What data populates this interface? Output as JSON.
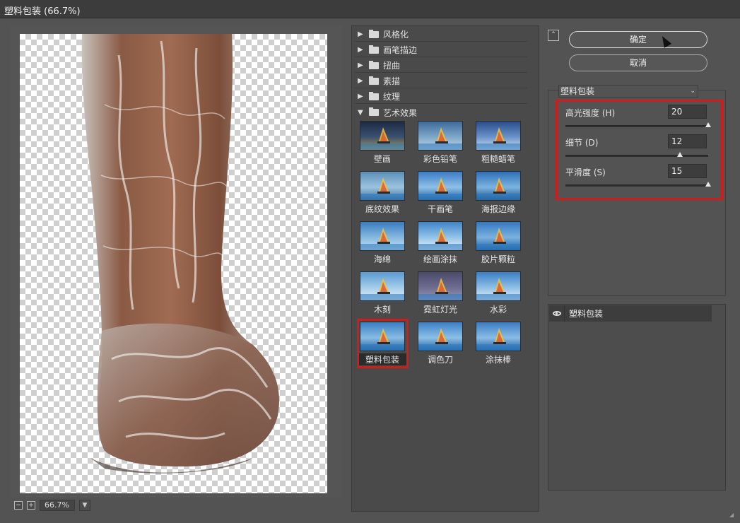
{
  "window": {
    "title": "塑料包装 (66.7%)"
  },
  "preview": {
    "zoom": "66.7%"
  },
  "categories": [
    {
      "label": "风格化",
      "expanded": false
    },
    {
      "label": "画笔描边",
      "expanded": false
    },
    {
      "label": "扭曲",
      "expanded": false
    },
    {
      "label": "素描",
      "expanded": false
    },
    {
      "label": "纹理",
      "expanded": false
    },
    {
      "label": "艺术效果",
      "expanded": true
    }
  ],
  "thumbnails": [
    {
      "label": "壁画"
    },
    {
      "label": "彩色铅笔"
    },
    {
      "label": "粗糙蜡笔"
    },
    {
      "label": "底纹效果"
    },
    {
      "label": "干画笔"
    },
    {
      "label": "海报边缘"
    },
    {
      "label": "海绵"
    },
    {
      "label": "绘画涂抹"
    },
    {
      "label": "胶片颗粒"
    },
    {
      "label": "木刻"
    },
    {
      "label": "霓虹灯光"
    },
    {
      "label": "水彩"
    },
    {
      "label": "塑料包装",
      "selected": true
    },
    {
      "label": "调色刀"
    },
    {
      "label": "涂抹棒"
    }
  ],
  "buttons": {
    "ok": "确定",
    "cancel": "取消"
  },
  "settings": {
    "filter_select": "塑料包装",
    "params": [
      {
        "label": "高光强度 (H)",
        "value": "20",
        "fraction": 1.0
      },
      {
        "label": "细节 (D)",
        "value": "12",
        "fraction": 0.8
      },
      {
        "label": "平滑度 (S)",
        "value": "15",
        "fraction": 1.0
      }
    ]
  },
  "layers": {
    "items": [
      {
        "name": "塑料包装",
        "visible": true
      }
    ]
  },
  "colors": {
    "highlight_box": "#d01c1c",
    "panel_bg": "#535353"
  }
}
